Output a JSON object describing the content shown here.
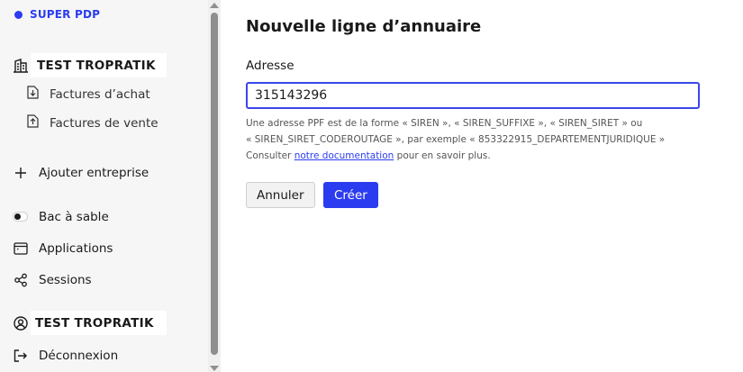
{
  "brand": {
    "name": "SUPER PDP"
  },
  "sidebar": {
    "org": {
      "name": "TEST TROPRATIK"
    },
    "sub_items": [
      {
        "label": "Factures d’achat",
        "icon": "download-document-icon"
      },
      {
        "label": "Factures de vente",
        "icon": "upload-document-icon"
      }
    ],
    "add_company": "Ajouter entreprise",
    "sandbox": "Bac à sable",
    "applications": "Applications",
    "sessions": "Sessions",
    "user": {
      "name": "TEST TROPRATIK"
    },
    "logout": "Déconnexion"
  },
  "main": {
    "title": "Nouvelle ligne d’annuaire",
    "field_label": "Adresse",
    "address_value": "315143296",
    "help_line1": "Une adresse PPF est de la forme « SIREN », « SIREN_SUFFIXE », « SIREN_SIRET » ou",
    "help_line2": "« SIREN_SIRET_CODEROUTAGE », par exemple « 853322915_DEPARTEMENTJURIDIQUE »",
    "help_prefix": "Consulter",
    "help_link": "notre documentation",
    "help_suffix": "pour en savoir plus.",
    "cancel": "Annuler",
    "create": "Créer"
  },
  "colors": {
    "accent": "#2b3cf0",
    "sidebar_bg": "#f6f6f6"
  }
}
